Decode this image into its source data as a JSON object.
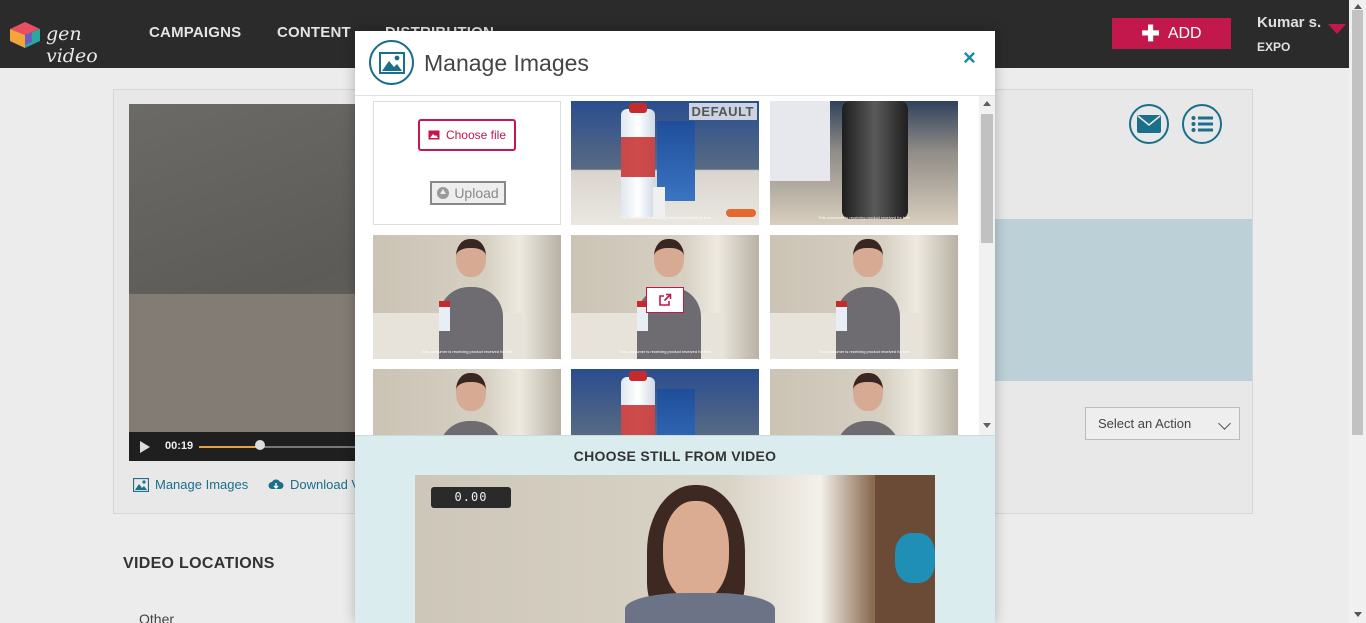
{
  "brand": {
    "name": "gen video"
  },
  "nav": {
    "items": [
      {
        "label": "CAMPAIGNS"
      },
      {
        "label": "CONTENT"
      },
      {
        "label": "DISTRIBUTION"
      }
    ],
    "add_label": "ADD",
    "user_name": "Kumar s.",
    "user_org": "EXPO"
  },
  "background": {
    "video_time": "00:19",
    "video_progress": 0.38,
    "manage_images_link": "Manage Images",
    "download_link": "Download V",
    "select_action": "Select an Action",
    "section_title": "VIDEO LOCATIONS",
    "location_item": "Other"
  },
  "modal": {
    "title": "Manage Images",
    "close_label": "×",
    "choose_file_label": "Choose file",
    "upload_label": "Upload",
    "default_badge": "DEFAULT",
    "thumbnails": [
      {
        "kind": "product",
        "caption": "This consumer is receiving product received for free",
        "is_default": true
      },
      {
        "kind": "closeup",
        "caption": "This consumer is receiving product received for free"
      },
      {
        "kind": "woman",
        "caption": "This consumer is receiving product received for free"
      },
      {
        "kind": "woman",
        "caption": "This consumer is receiving product received for free",
        "hovered": true
      },
      {
        "kind": "woman",
        "caption": "This consumer is receiving product received for free"
      },
      {
        "kind": "woman",
        "caption": ""
      },
      {
        "kind": "product",
        "caption": ""
      },
      {
        "kind": "woman",
        "caption": ""
      }
    ],
    "still_section_title": "CHOOSE STILL FROM VIDEO",
    "still_timecode": "0.00"
  },
  "colors": {
    "accent": "#c2184b",
    "teal": "#1a6f8a",
    "nav_bg": "#2b2b2b",
    "still_bg": "#dbecef"
  },
  "icons": {
    "logo": "cube-logo-icon",
    "add": "plus-icon",
    "user_menu": "caret-down-icon",
    "email": "envelope-icon",
    "list": "list-icon",
    "manage_images": "image-icon",
    "download": "cloud-download-icon",
    "select_action": "chevron-down-icon",
    "modal_header": "image-icon",
    "choose_file": "image-icon",
    "upload": "upload-circle-icon",
    "open_external": "external-link-icon",
    "close": "close-icon"
  }
}
